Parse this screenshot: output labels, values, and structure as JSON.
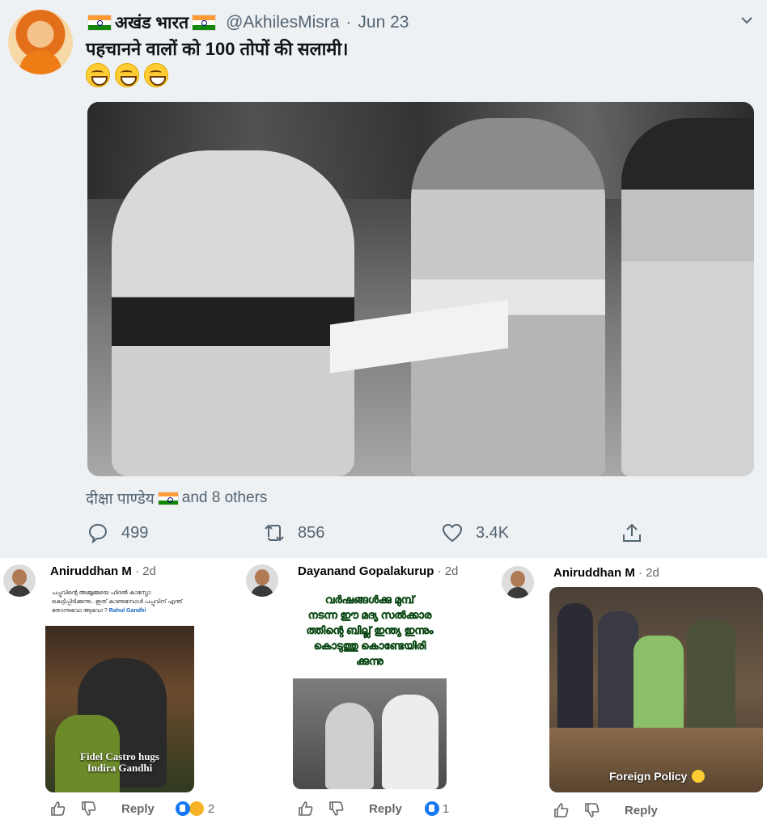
{
  "tweet": {
    "display_name": "अखंड भारत",
    "handle": "@AkhilesMisra",
    "separator": "·",
    "date": "Jun 23",
    "text": "पहचानने वालों को 100 तोपों की सलामी।",
    "emojis": [
      "grinning-face-with-smiling-eyes",
      "grinning-face-with-smiling-eyes",
      "grinning-face-with-smiling-eyes"
    ],
    "liked_by_name": "दीक्षा पाण्डेय",
    "liked_by_rest": "and 8 others",
    "replies": "499",
    "retweets": "856",
    "likes": "3.4K"
  },
  "comments": [
    {
      "author": "Aniruddhan M",
      "time": "· 2d",
      "image_text": "പപ്പുവിന്റെ അമ്മൂമ്മയെ ഫിദൽ കാസ്ട്രോ കെട്ടിപ്പിടിക്കുന്നു.. ഇത് കാണുമ്പോൾ പപ്പുവിന് എന്ത് തോന്നുവോ ആവോ ?",
      "image_tag": "Rahul Gandhi",
      "image_caption_1": "Fidel Castro hugs",
      "image_caption_2": "Indira Gandhi",
      "reply_label": "Reply",
      "reaction_count": "2"
    },
    {
      "author": "Dayanand Gopalakurup",
      "time": "· 2d",
      "image_text_1": "വർഷങ്ങൾക്കു മുമ്പ്",
      "image_text_2": "നടന്ന ഈ മദ്യ സൽക്കാര",
      "image_text_3": "ത്തിന്റെ ബില്ല് ഇന്ത്യ ഇന്നും",
      "image_text_4": "കൊടുത്തു കൊണ്ടേയിരി",
      "image_text_5": "ക്കുന്നു",
      "reply_label": "Reply",
      "reaction_count": "1"
    },
    {
      "author": "Aniruddhan M",
      "time": "· 2d",
      "image_caption": "Foreign Policy",
      "reply_label": "Reply"
    }
  ],
  "colors": {
    "tweet_bg": "#eef1f4",
    "muted": "#536471",
    "fb_blue": "#1877f2"
  }
}
